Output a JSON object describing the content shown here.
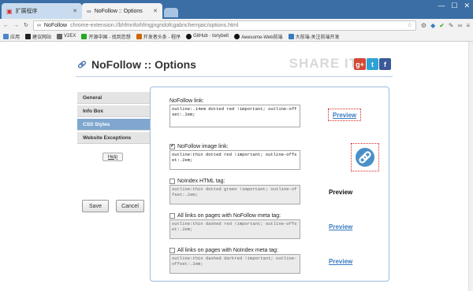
{
  "browser": {
    "tabs": [
      {
        "label": "扩展程序"
      },
      {
        "label": "NoFollow :: Options"
      }
    ],
    "url_host": "NoFollow",
    "url_path": "chrome-extension://bhfmnfoihfmgjngndofcgabnchemjaic/options.html",
    "bookmarks": [
      "应用",
      "建议网站",
      "V2EX",
      "开源中国 - 找到您想",
      "开发者头条 - 程序",
      "GitHub · tonybelt",
      "Awesome-Web前端",
      "大前端-关注前端开发"
    ]
  },
  "header": {
    "title": "NoFollow :: Options",
    "share_label": "SHARE IT",
    "social": [
      {
        "icon": "google-plus-icon",
        "glyph": "g+",
        "color": "#d34836"
      },
      {
        "icon": "twitter-icon",
        "glyph": "t",
        "color": "#2ea1d6"
      },
      {
        "icon": "facebook-icon",
        "glyph": "f",
        "color": "#3b5998"
      }
    ]
  },
  "sidebar": {
    "items": [
      {
        "label": "General"
      },
      {
        "label": "Info Box"
      },
      {
        "label": "CSS Styles"
      },
      {
        "label": "Website Exceptions"
      }
    ],
    "help_label": "Help",
    "save_label": "Save",
    "cancel_label": "Cancel"
  },
  "fields": {
    "nofollow_link": {
      "label": "NoFollow link:",
      "value": "outline:.14em dotted red !important; outline-offset:.2em;"
    },
    "nofollow_image": {
      "label": "NoFollow image link:",
      "checked": true,
      "value": "outline:thin dotted red !important; outline-offset:.2em;"
    },
    "noindex_html": {
      "label": "NoIndex HTML tag:",
      "checked": false,
      "value": "outline:thin dotted green !important; outline-offset:.2em;"
    },
    "nofollow_meta": {
      "label": "All links on pages with NoFollow meta tag:",
      "checked": false,
      "value": "outline:thin dashed red !important; outline-offset:.2em;"
    },
    "noindex_meta": {
      "label": "All links on pages with NoIndex meta tag:",
      "checked": false,
      "value": "outline:thin dashed darkred !important; outline-offset:.2em;"
    }
  },
  "previews": {
    "link": "Preview",
    "noindex": "Preview",
    "nofollow_meta": "Preview",
    "noindex_meta": "Preview"
  },
  "colors": {
    "accent": "#7fa7cf",
    "link": "#3a7bbf",
    "outline_red": "#dd2222",
    "border": "#9cbde0"
  }
}
